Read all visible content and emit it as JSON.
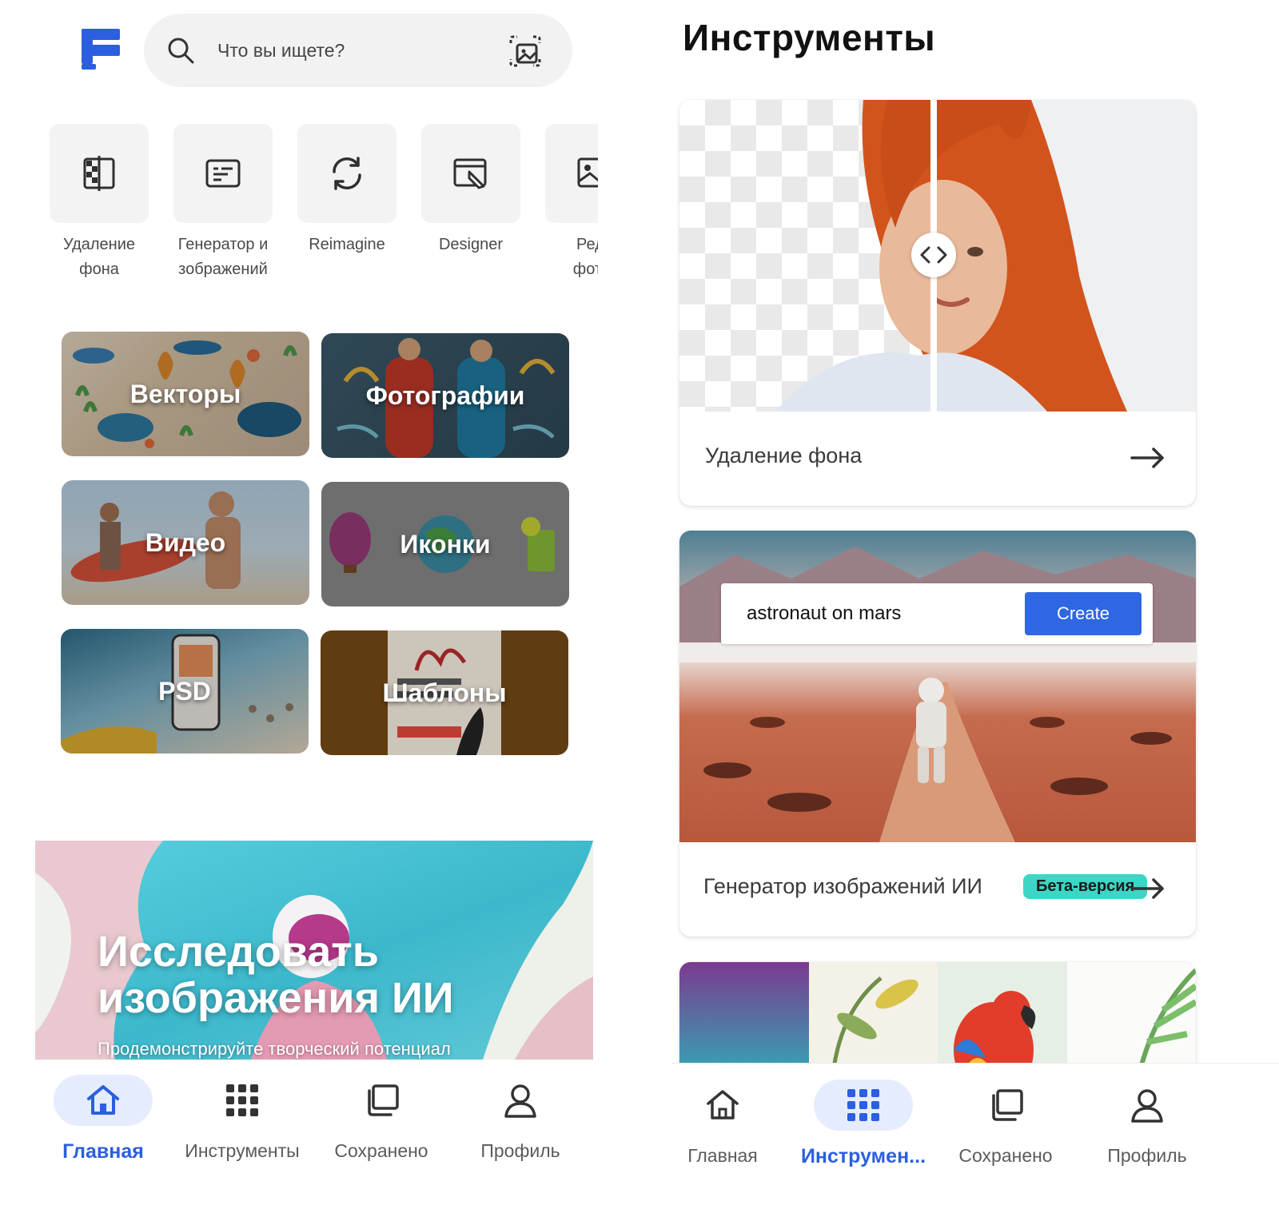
{
  "colors": {
    "accent": "#2b5fe0",
    "beta_badge": "#3bd6c5",
    "create_button": "#2f67e3"
  },
  "left": {
    "search": {
      "placeholder": "Что вы ищете?"
    },
    "tools": [
      {
        "label_1": "Удаление",
        "label_2": "фона",
        "icon": "background-removal-icon"
      },
      {
        "label_1": "Генератор и",
        "label_2": "зображений",
        "icon": "image-generator-icon"
      },
      {
        "label_1": "Reimagine",
        "label_2": "",
        "icon": "reimagine-icon"
      },
      {
        "label_1": "Designer",
        "label_2": "",
        "icon": "designer-icon"
      },
      {
        "label_1": "Реда",
        "label_2": "фотог",
        "icon": "photo-editor-icon"
      }
    ],
    "categories": [
      {
        "label": "Векторы"
      },
      {
        "label": "Фотографии"
      },
      {
        "label": "Видео"
      },
      {
        "label": "Иконки"
      },
      {
        "label": "PSD"
      },
      {
        "label": "Шаблоны"
      }
    ],
    "banner": {
      "title_line1": "Исследовать",
      "title_line2": "изображения ИИ",
      "subtitle": "Продемонстрируйте творческий потенциал"
    },
    "tabbar": [
      {
        "label": "Главная",
        "icon": "home-icon",
        "active": true
      },
      {
        "label": "Инструменты",
        "icon": "grid-icon",
        "active": false
      },
      {
        "label": "Сохранено",
        "icon": "collection-icon",
        "active": false
      },
      {
        "label": "Профиль",
        "icon": "profile-icon",
        "active": false
      }
    ]
  },
  "right": {
    "title": "Инструменты",
    "cards": [
      {
        "label": "Удаление фона"
      },
      {
        "label": "Генератор изображений ИИ",
        "badge": "Бета-версия",
        "prompt_value": "astronaut on mars",
        "button": "Create"
      }
    ],
    "tabbar": [
      {
        "label": "Главная",
        "icon": "home-icon",
        "active": false
      },
      {
        "label": "Инструмен...",
        "icon": "grid-icon",
        "active": true
      },
      {
        "label": "Сохранено",
        "icon": "collection-icon",
        "active": false
      },
      {
        "label": "Профиль",
        "icon": "profile-icon",
        "active": false
      }
    ]
  }
}
